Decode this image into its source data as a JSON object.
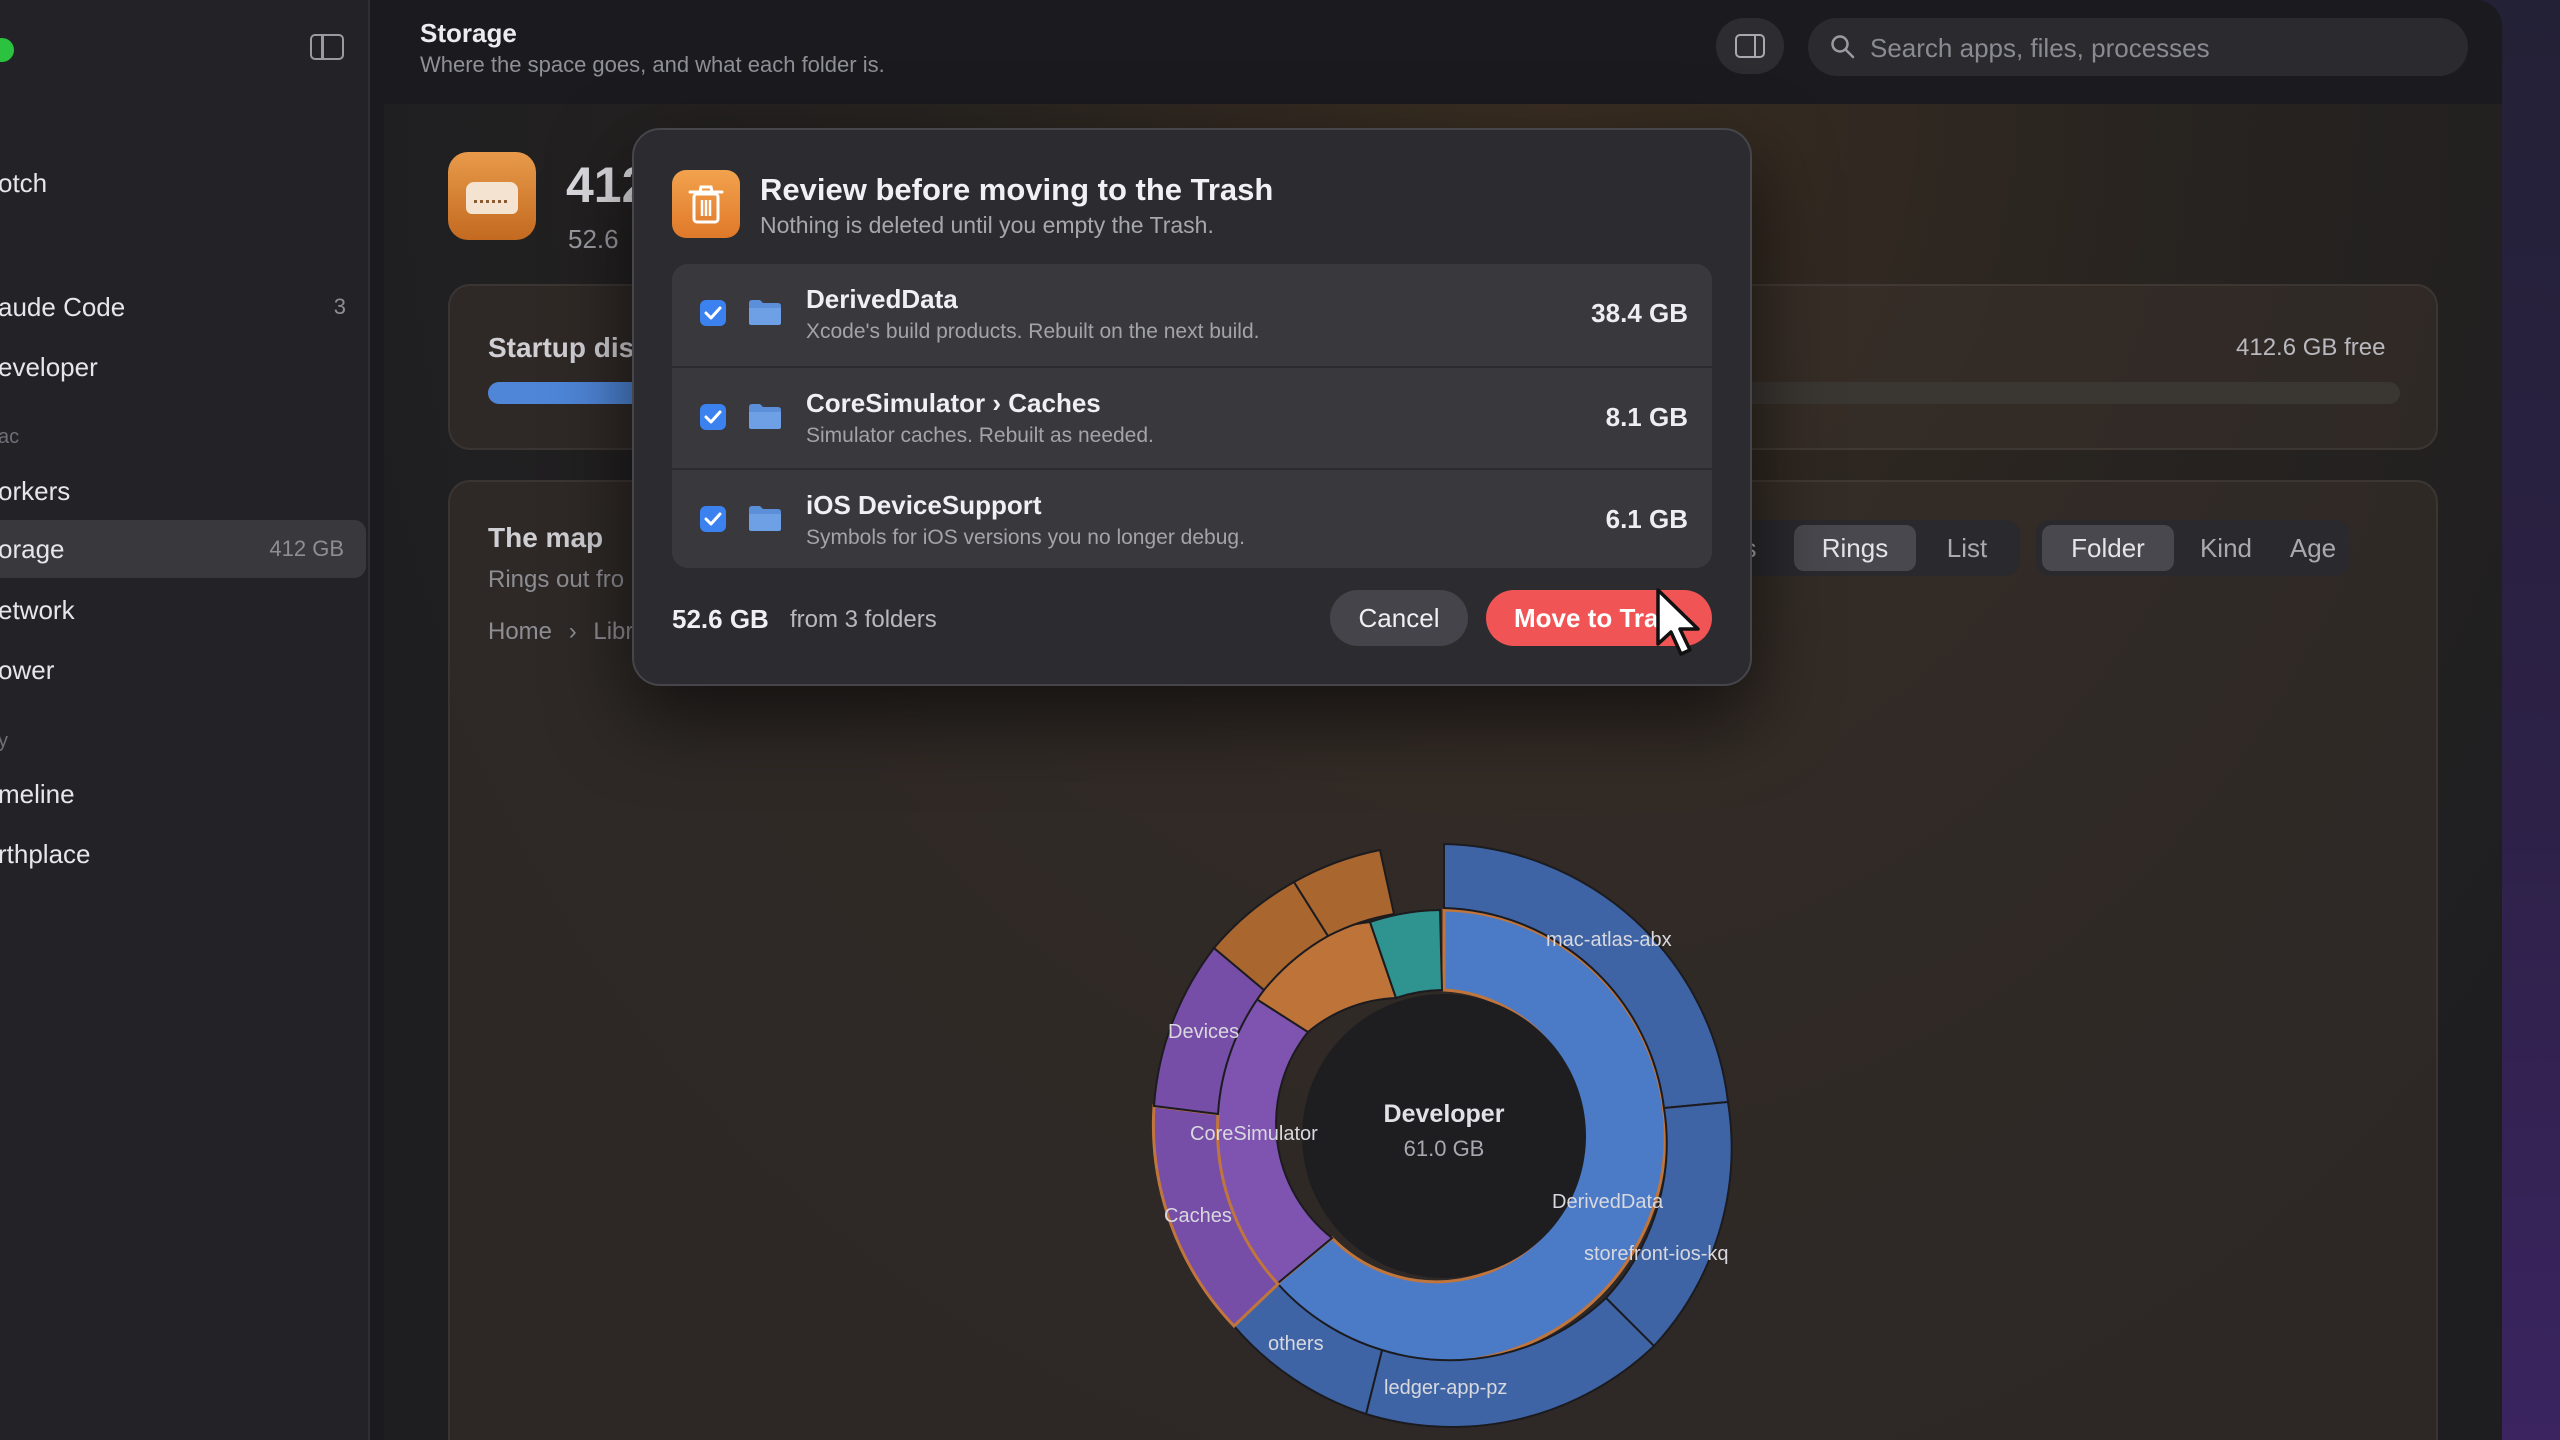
{
  "sidebar": {
    "items": [
      {
        "label": "otch",
        "count": ""
      },
      {
        "label": "aude Code",
        "count": "3"
      },
      {
        "label": "eveloper",
        "count": ""
      },
      {
        "label": "orkers",
        "count": ""
      },
      {
        "label": "orage",
        "count": "412 GB"
      },
      {
        "label": "etwork",
        "count": ""
      },
      {
        "label": "ower",
        "count": ""
      },
      {
        "label": "meline",
        "count": ""
      },
      {
        "label": "rthplace",
        "count": ""
      }
    ],
    "sections": [
      "ac",
      "y"
    ]
  },
  "toolbar": {
    "title": "Storage",
    "subtitle": "Where the space goes, and what each folder is.",
    "search_placeholder": "Search apps, files, processes"
  },
  "main": {
    "header_size": "412",
    "header_sub": "52.6",
    "startup_title": "Startup disl",
    "free_label": "412.6 GB free",
    "map_title": "The map",
    "map_sub": "Rings out fro",
    "breadcrumb": [
      "Home",
      "Libr"
    ],
    "view_modes": [
      "s",
      "Rings",
      "List"
    ],
    "group_modes": [
      "Folder",
      "Kind",
      "Age"
    ],
    "active_view": "Rings",
    "active_group": "Folder"
  },
  "sunburst": {
    "center_name": "Developer",
    "center_size": "61.0 GB",
    "labels": [
      "mac-atlas-abx",
      "Devices",
      "CoreSimulator",
      "Caches",
      "DerivedData",
      "storefront-ios-kq",
      "others",
      "ledger-app-pz"
    ]
  },
  "sheet": {
    "title": "Review before moving to the Trash",
    "subtitle": "Nothing is deleted until you empty the Trash.",
    "items": [
      {
        "name": "DerivedData",
        "desc": "Xcode's build products. Rebuilt on the next build.",
        "size": "38.4 GB",
        "checked": true
      },
      {
        "name": "CoreSimulator › Caches",
        "desc": "Simulator caches. Rebuilt as needed.",
        "size": "8.1 GB",
        "checked": true
      },
      {
        "name": "iOS DeviceSupport",
        "desc": "Symbols for iOS versions you no longer debug.",
        "size": "6.1 GB",
        "checked": true
      }
    ],
    "total": "52.6 GB",
    "total_from": "from 3 folders",
    "cancel_label": "Cancel",
    "confirm_label": "Move to Trash"
  },
  "colors": {
    "accent_blue": "#3b82f0",
    "destructive": "#f15454",
    "trash_icon": "#e98a36",
    "storage_fill": "#4f86d8"
  }
}
